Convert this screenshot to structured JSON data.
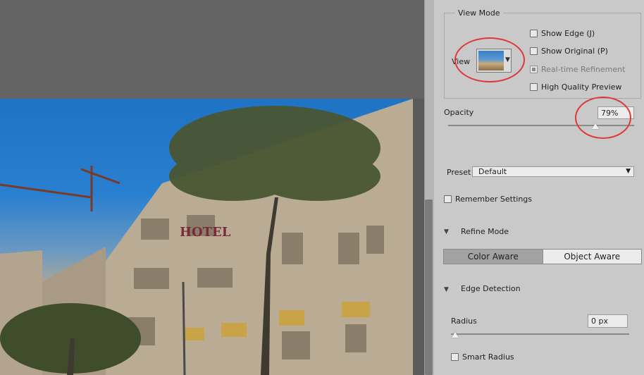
{
  "view_mode": {
    "legend": "View Mode",
    "view_label": "View",
    "show_edge": {
      "label": "Show Edge (J)",
      "checked": false
    },
    "show_original": {
      "label": "Show Original (P)",
      "checked": false
    },
    "realtime_refinement": {
      "label": "Real-time Refinement",
      "checked": true,
      "disabled": true
    },
    "high_quality_preview": {
      "label": "High Quality Preview",
      "checked": false
    }
  },
  "opacity": {
    "label": "Opacity",
    "value": "79%",
    "level_percent": 79
  },
  "preset": {
    "label": "Preset",
    "value": "Default"
  },
  "remember_settings": {
    "label": "Remember Settings",
    "checked": false
  },
  "refine_mode": {
    "title": "Refine Mode",
    "options": [
      "Color Aware",
      "Object Aware"
    ],
    "selected": "Color Aware"
  },
  "edge_detection": {
    "title": "Edge Detection",
    "radius_label": "Radius",
    "radius_value": "0 px",
    "radius_level_percent": 0,
    "smart_radius": {
      "label": "Smart Radius",
      "checked": false
    }
  },
  "icons": {
    "view_dropdown": "chevron-down-icon",
    "preset_dropdown": "chevron-down-icon",
    "section_toggle": "chevron-down-icon"
  },
  "colors": {
    "callout": "#e0373a",
    "panel_bg": "#c9c9c9",
    "canvas_bg": "#646464",
    "selected_segment": "#a3a3a3"
  }
}
